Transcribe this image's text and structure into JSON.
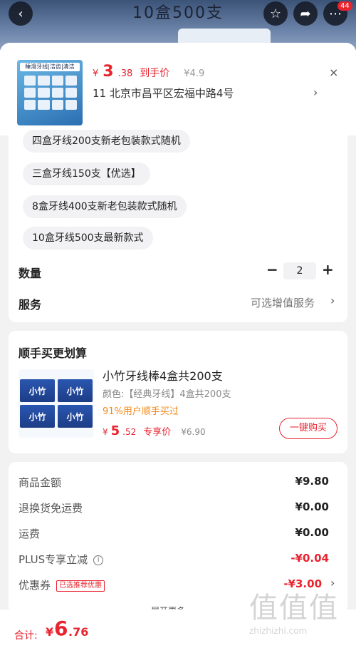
{
  "header": {
    "title": "10盒500支",
    "badge_count": "44",
    "back_icon": "back-arrow-icon",
    "fav_icon": "star-icon",
    "share_icon": "share-icon",
    "more_icon": "more-icon"
  },
  "product": {
    "thumb_text": "睡滑牙线|洁齿|清洁",
    "price_currency": "¥",
    "price_int": "3",
    "price_dec": ".38",
    "price_label": "到手价",
    "original_price": "¥4.9",
    "address": "11  北京市昌平区宏福中路4号",
    "chevron": "›",
    "close": "×"
  },
  "options": [
    "四盒牙线200支新老包装款式随机",
    "三盒牙线150支【优选】",
    "8盒牙线400支新老包装款式随机",
    "10盒牙线500支最新款式"
  ],
  "quantity": {
    "label": "数量",
    "minus": "−",
    "value": "2",
    "plus": "+"
  },
  "service": {
    "label": "服务",
    "value": "可选增值服务",
    "chevron": "›"
  },
  "bundle": {
    "title": "顺手买更划算",
    "thumb_label": "小竹",
    "name": "小竹牙线棒4盒共200支",
    "spec": "颜色:【经典牙线】4盒共200支",
    "percent": "91%用户顺手买过",
    "price_currency": "¥",
    "price_int": "5",
    "price_dec": ".52",
    "price_label": "专享价",
    "original_price": "¥6.90",
    "button": "一键购买"
  },
  "summary": {
    "rows": [
      {
        "label": "商品金额",
        "value": "¥9.80"
      },
      {
        "label": "退换货免运费",
        "value": "¥0.00"
      },
      {
        "label": "运费",
        "value": "¥0.00"
      },
      {
        "label": "PLUS专享立减",
        "value": "-¥0.04",
        "info": "i"
      },
      {
        "label": "优惠券",
        "value": "-¥3.00",
        "tag": "已选推荐优惠"
      }
    ],
    "expand": "展开更多 ⌄"
  },
  "footer": {
    "total_label": "合计:",
    "total_currency": "¥",
    "total_int": "6",
    "total_dec": ".76"
  },
  "watermark": {
    "glyphs": "值值值",
    "domain": "zhizhizhi.com"
  }
}
